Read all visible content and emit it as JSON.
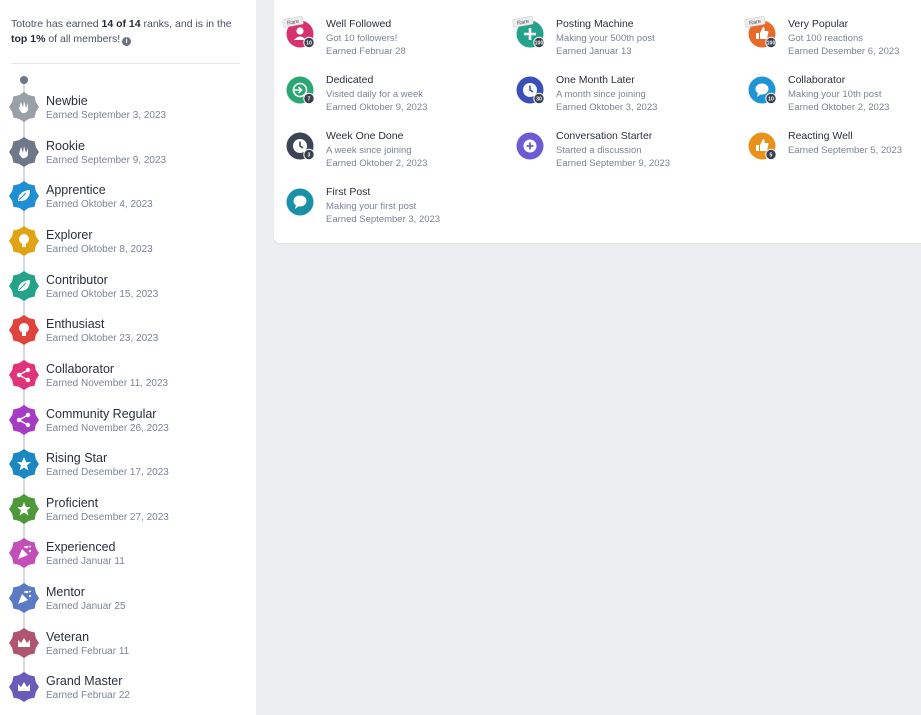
{
  "summary": {
    "prefix": "Tototre has earned ",
    "count": "14 of 14",
    "middle": " ranks, and is in the ",
    "top": "top 1%",
    "suffix": " of all members!",
    "info_icon": "i"
  },
  "ranks": [
    {
      "name": "Newbie",
      "earned": "Earned September 3, 2023",
      "color": "#9aa0a8",
      "icon": "hand-wave-icon"
    },
    {
      "name": "Rookie",
      "earned": "Earned September 9, 2023",
      "color": "#6f7888",
      "icon": "hand-wave-icon"
    },
    {
      "name": "Apprentice",
      "earned": "Earned Oktober 4, 2023",
      "color": "#1f8fd4",
      "icon": "leaf-icon"
    },
    {
      "name": "Explorer",
      "earned": "Earned Oktober 8, 2023",
      "color": "#e0a415",
      "icon": "lightbulb-icon"
    },
    {
      "name": "Contributor",
      "earned": "Earned Oktober 15, 2023",
      "color": "#22a38a",
      "icon": "leaf-icon"
    },
    {
      "name": "Enthusiast",
      "earned": "Earned Oktober 23, 2023",
      "color": "#e0433b",
      "icon": "lightbulb-icon"
    },
    {
      "name": "Collaborator",
      "earned": "Earned November 11, 2023",
      "color": "#e0337a",
      "icon": "share-icon"
    },
    {
      "name": "Community Regular",
      "earned": "Earned November 26, 2023",
      "color": "#a73bc4",
      "icon": "share-icon"
    },
    {
      "name": "Rising Star",
      "earned": "Earned Desember 17, 2023",
      "color": "#1b87c2",
      "icon": "star-icon"
    },
    {
      "name": "Proficient",
      "earned": "Earned Desember 27, 2023",
      "color": "#4e9a3a",
      "icon": "star-icon"
    },
    {
      "name": "Experienced",
      "earned": "Earned Januar 11",
      "color": "#c24fb8",
      "icon": "party-icon"
    },
    {
      "name": "Mentor",
      "earned": "Earned Januar 25",
      "color": "#5a7bc4",
      "icon": "party-icon"
    },
    {
      "name": "Veteran",
      "earned": "Earned Februar 11",
      "color": "#b0546f",
      "icon": "crown-icon"
    },
    {
      "name": "Grand Master",
      "earned": "Earned Februar 22",
      "color": "#6a5bb8",
      "icon": "crown-icon"
    }
  ],
  "achievements": [
    {
      "title": "Well Followed",
      "desc": "Got 10 followers!",
      "earned": "Earned Februar 28",
      "color": "#d6326e",
      "count": "10",
      "rare": "Rare",
      "icon": "user-icon"
    },
    {
      "title": "Posting Machine",
      "desc": "Making your 500th post",
      "earned": "Earned Januar 13",
      "color": "#23a38a",
      "count": "100",
      "rare": "Rare",
      "icon": "plus-icon"
    },
    {
      "title": "Very Popular",
      "desc": "Got 100 reactions",
      "earned": "Earned Desember 6, 2023",
      "color": "#e86a2a",
      "count": "100",
      "rare": "Rare",
      "icon": "thumbs-up-icon"
    },
    {
      "title": "Dedicated",
      "desc": "Visited daily for a week",
      "earned": "Earned Oktober 9, 2023",
      "color": "#2aa773",
      "count": "7",
      "rare": "",
      "icon": "login-icon"
    },
    {
      "title": "One Month Later",
      "desc": "A month since joining",
      "earned": "Earned Oktober 3, 2023",
      "color": "#3a4fb8",
      "count": "30",
      "rare": "",
      "icon": "clock-icon"
    },
    {
      "title": "Collaborator",
      "desc": "Making your 10th post",
      "earned": "Earned Oktober 2, 2023",
      "color": "#1f95d6",
      "count": "10",
      "rare": "",
      "icon": "chat-bubble-icon"
    },
    {
      "title": "Week One Done",
      "desc": "A week since joining",
      "earned": "Earned Oktober 2, 2023",
      "color": "#3b4354",
      "count": "3",
      "rare": "",
      "icon": "clock-icon"
    },
    {
      "title": "Conversation Starter",
      "desc": "Started a discussion",
      "earned": "Earned September 9, 2023",
      "color": "#6c5ad6",
      "count": "",
      "rare": "",
      "icon": "plus-circle-icon"
    },
    {
      "title": "Reacting Well",
      "desc": "",
      "earned": "Earned September 5, 2023",
      "color": "#e8921a",
      "count": "5",
      "rare": "",
      "icon": "thumbs-up-icon"
    },
    {
      "title": "First Post",
      "desc": "Making your first post",
      "earned": "Earned September 3, 2023",
      "color": "#1a8fa8",
      "count": "",
      "rare": "",
      "icon": "chat-bubble-icon"
    }
  ]
}
